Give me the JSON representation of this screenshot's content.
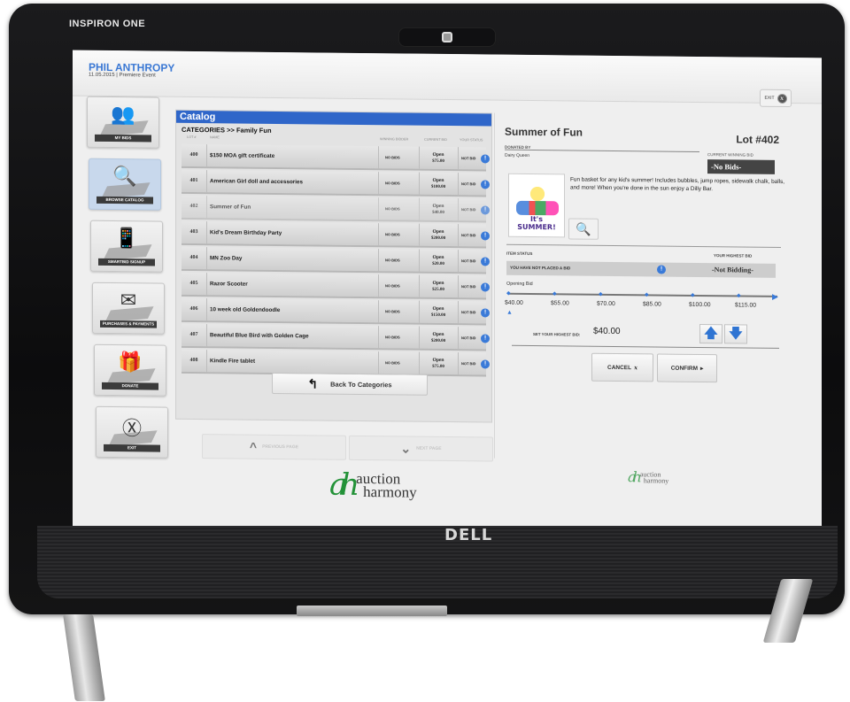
{
  "device": {
    "model_label": "INSPIRON ONE",
    "brand_logo": "DELL"
  },
  "header": {
    "user_name": "PHIL ANTHROPY",
    "event_line": "11.05.2015 | Premiere Event",
    "exit_label": "EXIT",
    "exit_icon": "x-circle-icon"
  },
  "sidenav": {
    "items": [
      {
        "label": "MY BIDS",
        "icon": "users-icon",
        "active": false
      },
      {
        "label": "BROWSE CATALOG",
        "icon": "magnifier-icon",
        "active": true
      },
      {
        "label": "SMARTBID SIGNUP",
        "icon": "phone-icon",
        "active": false
      },
      {
        "label": "PURCHASES & PAYMENTS",
        "icon": "envelope-icon",
        "active": false
      },
      {
        "label": "DONATE",
        "icon": "gift-icon",
        "active": false
      },
      {
        "label": "EXIT",
        "icon": "x-circle-icon",
        "active": false
      }
    ]
  },
  "catalog": {
    "title": "Catalog",
    "breadcrumb": "CATEGORIES >> Family Fun",
    "columns": {
      "lot": "LOT #",
      "name": "NAME",
      "winning": "WINNING BIDDER",
      "current": "CURRENT BID",
      "status": "YOUR STATUS"
    },
    "rows": [
      {
        "lot": "400",
        "name": "$150 MOA gift certificate",
        "winning": "NO BIDS",
        "bid_state": "Open",
        "bid": "$75.00",
        "status": "NOT BID"
      },
      {
        "lot": "401",
        "name": "American Girl doll and accessories",
        "winning": "NO BIDS",
        "bid_state": "Open",
        "bid": "$100.00",
        "status": "NOT BID"
      },
      {
        "lot": "402",
        "name": "Summer of Fun",
        "winning": "NO BIDS",
        "bid_state": "Open",
        "bid": "$40.00",
        "status": "NOT BID"
      },
      {
        "lot": "403",
        "name": "Kid's Dream Birthday Party",
        "winning": "NO BIDS",
        "bid_state": "Open",
        "bid": "$200.00",
        "status": "NOT BID"
      },
      {
        "lot": "404",
        "name": "MN Zoo Day",
        "winning": "NO BIDS",
        "bid_state": "Open",
        "bid": "$20.00",
        "status": "NOT BID"
      },
      {
        "lot": "405",
        "name": "Razor Scooter",
        "winning": "NO BIDS",
        "bid_state": "Open",
        "bid": "$25.00",
        "status": "NOT BID"
      },
      {
        "lot": "406",
        "name": "10 week old Goldendoodle",
        "winning": "NO BIDS",
        "bid_state": "Open",
        "bid": "$150.00",
        "status": "NOT BID"
      },
      {
        "lot": "407",
        "name": "Beautiful Blue Bird with Golden Cage",
        "winning": "NO BIDS",
        "bid_state": "Open",
        "bid": "$200.00",
        "status": "NOT BID"
      },
      {
        "lot": "408",
        "name": "Kindle Fire tablet",
        "winning": "NO BIDS",
        "bid_state": "Open",
        "bid": "$75.00",
        "status": "NOT BID"
      }
    ],
    "back_label": "Back To Categories",
    "prev_label": "PREVIOUS PAGE",
    "next_label": "NEXT PAGE"
  },
  "detail": {
    "title": "Summer of Fun",
    "lot": "Lot #402",
    "donated_by_label": "DONATED BY",
    "donor": "Dairy Queen",
    "current_winning_label": "CURRENT WINNING BID",
    "current_winning": "-No Bids-",
    "image_caption": "It's SUMMER!",
    "description": "Fun basket for any kid's summer! Includes bubbles, jump ropes, sidewalk chalk, balls, and more! When you're done in the sun enjoy a Dilly Bar.",
    "item_status_label": "ITEM STATUS",
    "your_highest_label": "YOUR HIGHEST BID",
    "status_text": "YOU HAVE NOT PLACED A BID",
    "your_highest": "-Not Bidding-",
    "opening_bid_label": "Opening Bid",
    "bid_steps": [
      "$40.00",
      "$55.00",
      "$70.00",
      "$85.00",
      "$100.00",
      "$115.00"
    ],
    "selected_step_index": 0,
    "set_highest_label": "SET YOUR HIGHEST BID:",
    "set_highest_value": "$40.00",
    "cancel_label": "CANCEL",
    "confirm_label": "CONFIRM"
  },
  "branding": {
    "logo_line1": "auction",
    "logo_line2": "harmony",
    "logo_mark": "ah"
  },
  "colors": {
    "accent": "#2f66c9",
    "alert": "#3a7ad8",
    "logo_green": "#239238"
  }
}
